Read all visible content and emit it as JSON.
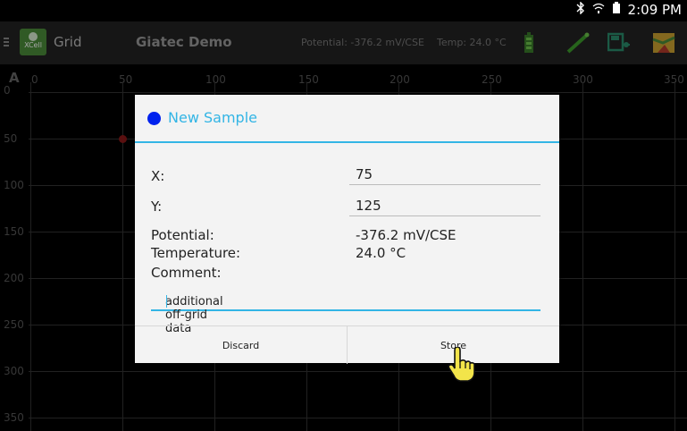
{
  "status": {
    "time": "2:09 PM"
  },
  "actionbar": {
    "app_label": "Grid",
    "logo_text": "XCell",
    "title": "Giatec Demo",
    "potential": "Potential: -376.2 mV/CSE",
    "temp": "Temp: 24.0 °C"
  },
  "plot": {
    "corner_label": "A",
    "x_ticks": [
      "0",
      "50",
      "100",
      "150",
      "200",
      "250",
      "300",
      "350"
    ],
    "y_ticks": [
      "0",
      "50",
      "100",
      "150",
      "200",
      "250",
      "300",
      "350"
    ]
  },
  "dialog": {
    "title": "New Sample",
    "x_label": "X:",
    "x_value": "75",
    "y_label": "Y:",
    "y_value": "125",
    "potential_label": "Potential:",
    "potential_value": "-376.2 mV/CSE",
    "temperature_label": "Temperature:",
    "temperature_value": "24.0 °C",
    "comment_label": "Comment:",
    "comment_value": "additional off-grid data",
    "discard_label": "Discard",
    "store_label": "Store"
  },
  "colors": {
    "accent": "#33b5e5",
    "dialog_dot": "#0022ee",
    "point": "#8a1a1a"
  }
}
